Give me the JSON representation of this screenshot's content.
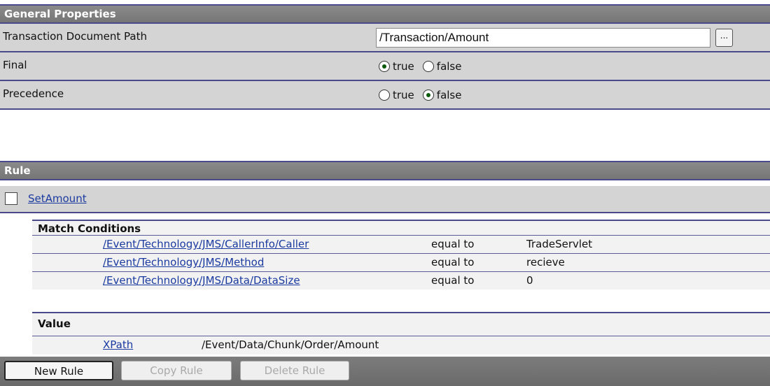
{
  "general": {
    "header": "General Properties",
    "path_label": "Transaction Document Path",
    "path_value": "/Transaction/Amount",
    "browse_label": "...",
    "final_label": "Final",
    "precedence_label": "Precedence",
    "option_true": "true",
    "option_false": "false",
    "final_selected": "true",
    "precedence_selected": "false"
  },
  "rule": {
    "header": "Rule",
    "name": "SetAmount",
    "match_header": "Match Conditions",
    "conditions": [
      {
        "path": "/Event/Technology/JMS/CallerInfo/Caller",
        "operator": "equal to",
        "value": "TradeServlet"
      },
      {
        "path": "/Event/Technology/JMS/Method",
        "operator": "equal to",
        "value": "recieve"
      },
      {
        "path": "/Event/Technology/JMS/Data/DataSize",
        "operator": "equal to",
        "value": "0"
      }
    ],
    "value_header": "Value",
    "value_type": "XPath",
    "value_expr": "/Event/Data/Chunk/Order/Amount"
  },
  "buttons": {
    "new_rule": "New Rule",
    "copy_rule": "Copy Rule",
    "delete_rule": "Delete Rule"
  }
}
